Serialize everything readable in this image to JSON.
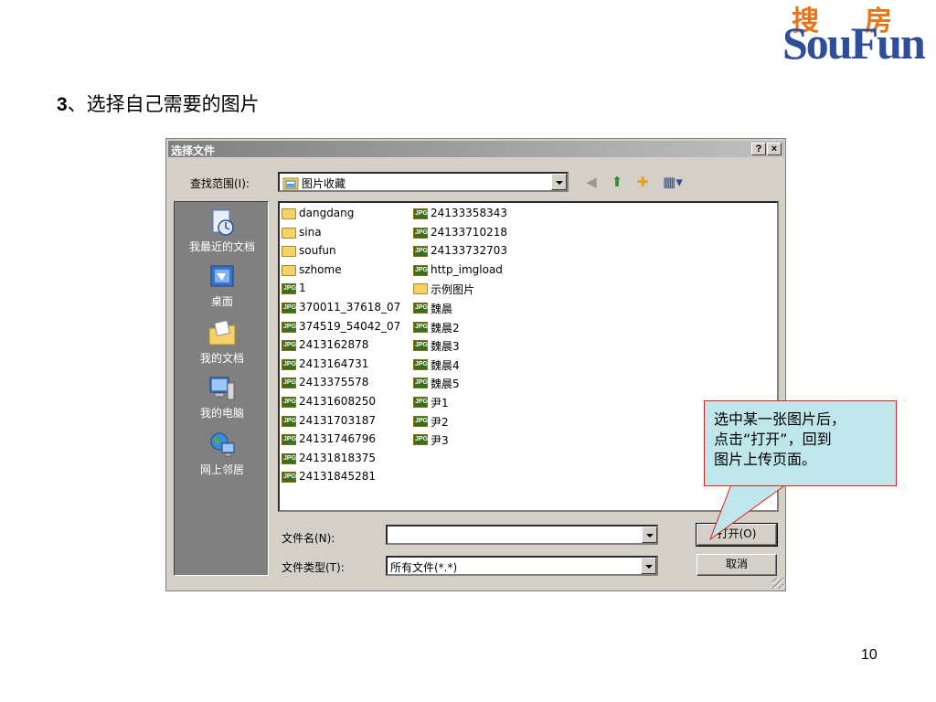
{
  "slide": {
    "title_number": "3",
    "title_text": "、选择自己需要的图片",
    "page_number": "10"
  },
  "logo": {
    "cn_left": "搜",
    "cn_right": "房",
    "en": "SouFun",
    "colors": {
      "orange": "#e8741a",
      "blue": "#2e4f97"
    }
  },
  "dialog": {
    "title": "选择文件",
    "help_button": "?",
    "close_button": "×",
    "look_in_label": "查找范围(I):",
    "look_in_value": "图片收藏",
    "places": [
      {
        "label": "我最近的文档",
        "icon": "recent-documents-icon"
      },
      {
        "label": "桌面",
        "icon": "desktop-icon"
      },
      {
        "label": "我的文档",
        "icon": "my-documents-icon"
      },
      {
        "label": "我的电脑",
        "icon": "my-computer-icon"
      },
      {
        "label": "网上邻居",
        "icon": "network-places-icon"
      }
    ],
    "files_col1": [
      {
        "name": "dangdang",
        "type": "folder"
      },
      {
        "name": "sina",
        "type": "folder"
      },
      {
        "name": "soufun",
        "type": "folder"
      },
      {
        "name": "szhome",
        "type": "folder"
      },
      {
        "name": "1",
        "type": "jpg"
      },
      {
        "name": "370011_37618_07",
        "type": "jpg"
      },
      {
        "name": "374519_54042_07",
        "type": "jpg"
      },
      {
        "name": "2413162878",
        "type": "jpg"
      },
      {
        "name": "2413164731",
        "type": "jpg"
      },
      {
        "name": "2413375578",
        "type": "jpg"
      },
      {
        "name": "24131608250",
        "type": "jpg"
      },
      {
        "name": "24131703187",
        "type": "jpg"
      },
      {
        "name": "24131746796",
        "type": "jpg"
      },
      {
        "name": "24131818375",
        "type": "jpg"
      },
      {
        "name": "24131845281",
        "type": "jpg"
      }
    ],
    "files_col2": [
      {
        "name": "24133358343",
        "type": "jpg"
      },
      {
        "name": "24133710218",
        "type": "jpg"
      },
      {
        "name": "24133732703",
        "type": "jpg"
      },
      {
        "name": "http_imgload",
        "type": "jpg"
      },
      {
        "name": "示例图片",
        "type": "folder"
      },
      {
        "name": "魏晨",
        "type": "jpg"
      },
      {
        "name": "魏晨2",
        "type": "jpg"
      },
      {
        "name": "魏晨3",
        "type": "jpg"
      },
      {
        "name": "魏晨4",
        "type": "jpg"
      },
      {
        "name": "魏晨5",
        "type": "jpg"
      },
      {
        "name": "尹1",
        "type": "jpg"
      },
      {
        "name": "尹2",
        "type": "jpg"
      },
      {
        "name": "尹3",
        "type": "jpg"
      }
    ],
    "file_name_label": "文件名(N):",
    "file_name_value": "",
    "file_type_label": "文件类型(T):",
    "file_type_value": "所有文件(*.*)",
    "open_button": "打开(O)",
    "cancel_button": "取消"
  },
  "callout": {
    "text_line1": "选中某一张图片后，",
    "text_line2": "点击“打开”，回到",
    "text_line3": "图片上传页面。"
  }
}
